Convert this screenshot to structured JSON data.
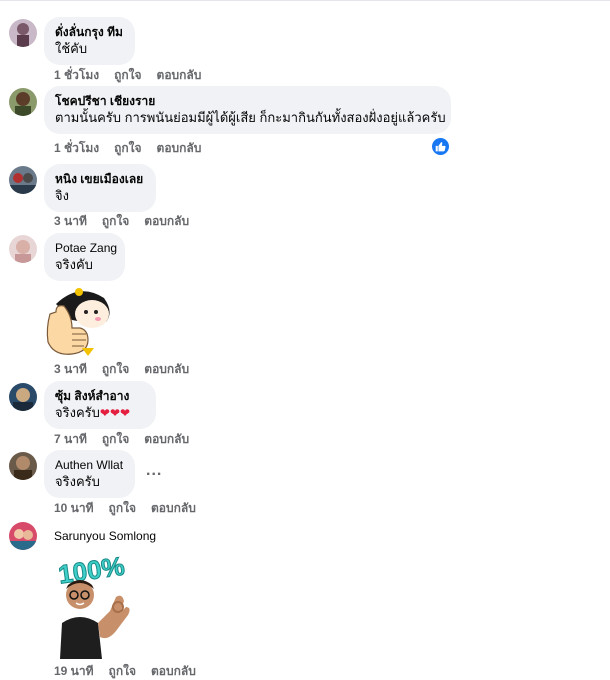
{
  "comments": [
    {
      "name": "ดั่งลั่นกรุง ทีม",
      "text": "ใช้คับ",
      "time": "1 ชั่วโมง",
      "like": "ถูกใจ",
      "reply": "ตอบกลับ"
    },
    {
      "name": "โชคปรีชา เชียงราย",
      "text": "ตามนั้นครับ การพนันย่อมมีผู้ได้ผู้เสีย ก็กะมากินกันทั้งสองฝั่งอยู่แล้วครับ",
      "time": "1 ชั่วโมง",
      "like": "ถูกใจ",
      "reply": "ตอบกลับ"
    },
    {
      "name": "หนิง เขยเมืองเลย",
      "text": "จิง",
      "time": "3 นาที",
      "like": "ถูกใจ",
      "reply": "ตอบกลับ"
    },
    {
      "name": "Potae Zang",
      "text": "จริงคับ",
      "time": "3 นาที",
      "like": "ถูกใจ",
      "reply": "ตอบกลับ"
    },
    {
      "name": "ซุ้ม สิงห์สำอาง",
      "text": "จริงครับ",
      "emoji": "❤❤❤",
      "time": "7 นาที",
      "like": "ถูกใจ",
      "reply": "ตอบกลับ"
    },
    {
      "name": "Authen Wllat",
      "text": "จริงครับ",
      "time": "10 นาที",
      "like": "ถูกใจ",
      "reply": "ตอบกลับ",
      "more": "..."
    },
    {
      "name": "Sarunyou Somlong",
      "sticker_text": "100%",
      "time": "19 นาที",
      "like": "ถูกใจ",
      "reply": "ตอบกลับ"
    }
  ],
  "colors": {
    "bubble": "#f0f2f5",
    "meta": "#65676b",
    "like_badge": "#1877f2",
    "heart": "#e41e3f"
  }
}
